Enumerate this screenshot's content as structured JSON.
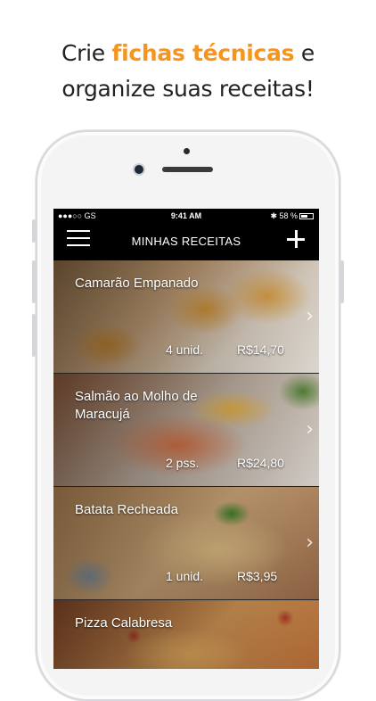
{
  "headline": {
    "line1_pre": "Crie ",
    "line1_accent": "fichas técnicas",
    "line1_post": " e",
    "line2": "organize suas receitas!"
  },
  "colors": {
    "accent": "#f7941d",
    "navbar": "#000000"
  },
  "statusbar": {
    "carrier": "●●●○○ GS",
    "time": "9:41 AM",
    "battery": "58 %"
  },
  "navbar": {
    "menu_icon": "hamburger-menu-icon",
    "title": "MINHAS RECEITAS",
    "add_icon": "plus-icon"
  },
  "recipes": [
    {
      "name": "Camarão Empanado",
      "qty": "4 unid.",
      "price": "R$14,70"
    },
    {
      "name": "Salmão ao Molho de Maracujá",
      "qty": "2 pss.",
      "price": "R$24,80"
    },
    {
      "name": "Batata Recheada",
      "qty": "1 unid.",
      "price": "R$3,95"
    },
    {
      "name": "Pizza Calabresa",
      "qty": "",
      "price": ""
    }
  ]
}
